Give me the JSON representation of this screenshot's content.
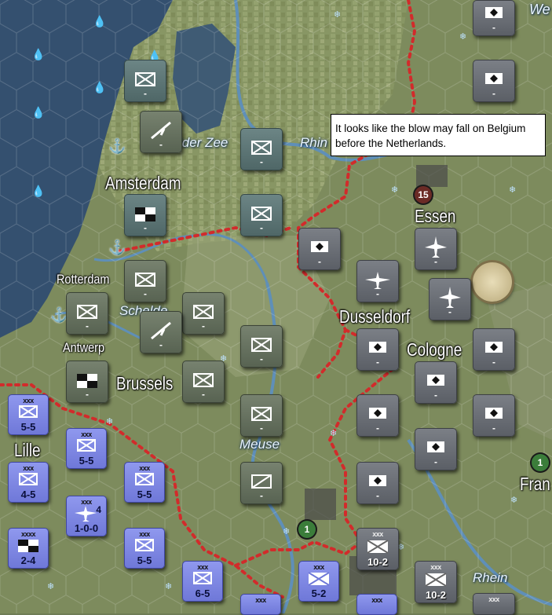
{
  "tooltip": {
    "text": "It looks like the blow may fall on Belgium before the Netherlands."
  },
  "cities": {
    "amsterdam": "Amsterdam",
    "rotterdam": "Rotterdam",
    "antwerp": "Antwerp",
    "brussels": "Brussels",
    "lille": "Lille",
    "essen": "Essen",
    "dusseldorf": "Dusseldorf",
    "cologne": "Cologne",
    "france_partial": "Fran",
    "we_partial": "We"
  },
  "rivers": {
    "zuider_zee": "ider Zee",
    "rhin": "Rhin",
    "schelde": "Schelde",
    "meuse": "Meuse",
    "rhein": "Rhein"
  },
  "badges": {
    "essen_count": "15",
    "hex_a": "1",
    "hex_b": "1"
  },
  "colors": {
    "germany": "#6b6f76",
    "netherlands": "#5e7676",
    "belgium": "#667160",
    "france": "#7e87e6",
    "sea": "#34506f",
    "border": "#cc2222"
  },
  "units": {
    "french": [
      {
        "echelon": "xxx",
        "strength": "5-5"
      },
      {
        "echelon": "xxx",
        "strength": "5-5"
      },
      {
        "echelon": "xxx",
        "strength": "4-5"
      },
      {
        "echelon": "xxx",
        "strength": "5-5"
      },
      {
        "echelon": "xxx",
        "strength": "5-5"
      },
      {
        "echelon": "xxxx",
        "strength": "2-4"
      },
      {
        "echelon": "xxx",
        "strength": "6-5"
      },
      {
        "echelon": "xxx",
        "strength": "5-2"
      },
      {
        "echelon": "xxx",
        "strength": ""
      },
      {
        "echelon": "xxx",
        "strength": ""
      }
    ],
    "french_air": {
      "echelon": "xxx",
      "strength": "1-0-0",
      "count": "4"
    },
    "german_armies": [
      {
        "echelon": "xxx",
        "strength": "10-2"
      },
      {
        "echelon": "xxx",
        "strength": "10-2"
      },
      {
        "echelon": "xxx",
        "strength": ""
      }
    ],
    "dash": "-"
  }
}
